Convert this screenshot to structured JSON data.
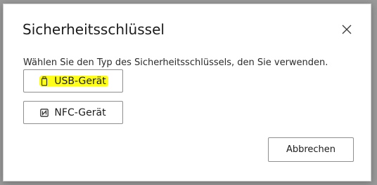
{
  "dialog": {
    "title": "Sicherheitsschlüssel",
    "description": "Wählen Sie den Typ des Sicherheitsschlüssels, den Sie verwenden.",
    "close_icon": "close-icon"
  },
  "options": {
    "usb": {
      "label": "USB-Gerät",
      "icon": "usb-key-icon",
      "highlight_color": "#ffff1a"
    },
    "nfc": {
      "label": "NFC-Gerät",
      "icon": "nfc-icon"
    }
  },
  "actions": {
    "cancel_label": "Abbrechen"
  }
}
